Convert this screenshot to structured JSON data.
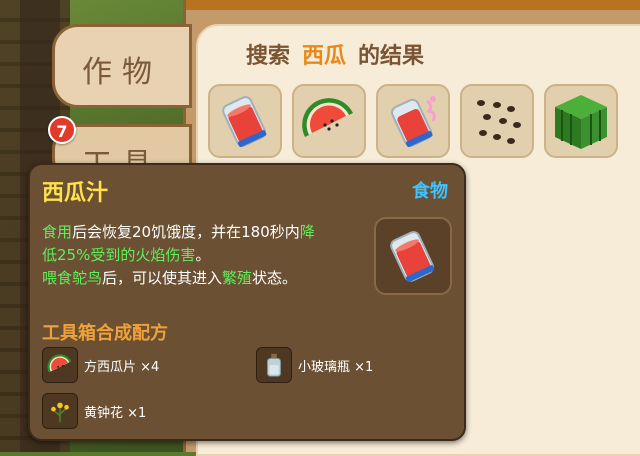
{
  "tabs": [
    {
      "label": "作物"
    },
    {
      "label": "工具",
      "badge": "7"
    }
  ],
  "search": {
    "prefix": "搜索",
    "keyword": "西瓜",
    "suffix": "的结果"
  },
  "results": [
    {
      "icon": "watermelon-juice-icon"
    },
    {
      "icon": "watermelon-slice-icon"
    },
    {
      "icon": "watermelon-juice-splash-icon"
    },
    {
      "icon": "watermelon-seeds-icon"
    },
    {
      "icon": "watermelon-block-icon"
    }
  ],
  "tooltip": {
    "title": "西瓜汁",
    "category": "食物",
    "desc": {
      "l1_a": "食用",
      "l1_b": "后会恢复20饥饿度，并在180秒内",
      "l1_c": "降",
      "l2_a": "低25%受到的火焰伤害",
      "l2_b": "。",
      "l3_a": "喂食鸵鸟",
      "l3_b": "后，可以使其进入",
      "l3_c": "繁殖",
      "l3_d": "状态。"
    },
    "recipe_title": "工具箱合成配方",
    "ingredients": [
      {
        "icon": "watermelon-slice-icon",
        "text": "方西瓜片 ×4"
      },
      {
        "icon": "glass-bottle-icon",
        "text": "小玻璃瓶 ×1"
      },
      {
        "icon": "yellow-flower-icon",
        "text": "黄钟花 ×1"
      }
    ]
  },
  "colors": {
    "keyword": "#e8881a",
    "title": "#ffe14a",
    "category": "#3ec3ff",
    "highlight": "#5ff05a",
    "recipe": "#f0a23a"
  }
}
